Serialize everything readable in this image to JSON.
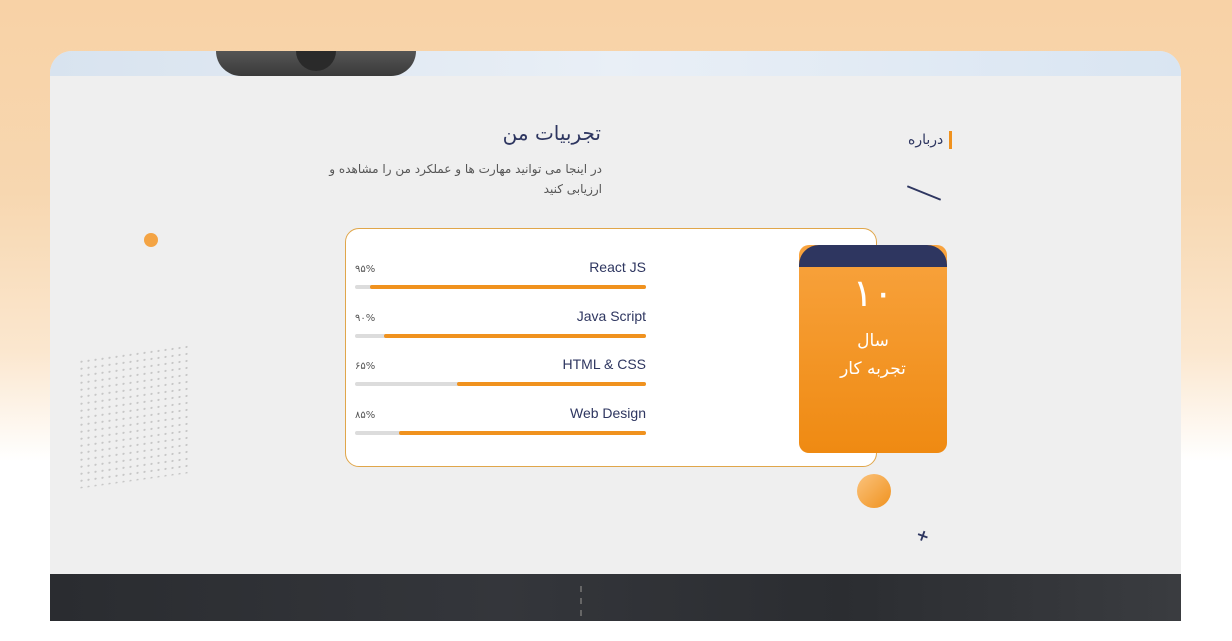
{
  "about": {
    "label": "درباره"
  },
  "section": {
    "title": "تجربیات من",
    "subtitle": "در اینجا می توانید مهارت ها و عملکرد من را مشاهده و ارزیابی کنید"
  },
  "skills": [
    {
      "name": "React JS",
      "percent_label": "۹۵%",
      "value": 0.95
    },
    {
      "name": "Java Script",
      "percent_label": "۹۰%",
      "value": 0.9
    },
    {
      "name": "HTML & CSS",
      "percent_label": "۶۵%",
      "value": 0.65
    },
    {
      "name": "Web Design",
      "percent_label": "۸۵%",
      "value": 0.85
    }
  ],
  "experience": {
    "number": "۱۰",
    "line1": "سال",
    "line2": "تجربه کار"
  },
  "colors": {
    "accent": "#f0921e",
    "navy": "#2e3660",
    "track": "#dcdcdc"
  }
}
